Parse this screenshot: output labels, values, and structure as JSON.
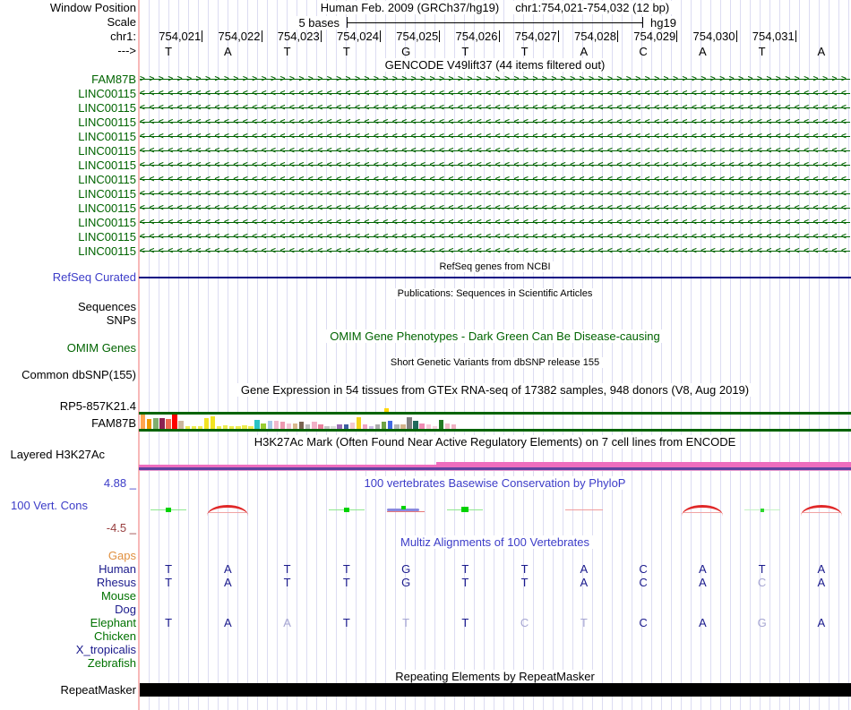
{
  "header": {
    "window_position_label": "Window Position",
    "assembly_title": "Human Feb. 2009 (GRCh37/hg19)",
    "position_title": "chr1:754,021-754,032 (12 bp)",
    "scale_label": "Scale",
    "scale_value": "5 bases",
    "assembly_tag": "hg19",
    "chrom_label": "chr1:",
    "strand_label": "--->"
  },
  "ruler": {
    "coordinates": [
      "754,021",
      "754,022",
      "754,023",
      "754,024",
      "754,025",
      "754,026",
      "754,027",
      "754,028",
      "754,029",
      "754,030",
      "754,031"
    ]
  },
  "sequence": {
    "bases": [
      "T",
      "A",
      "T",
      "T",
      "G",
      "T",
      "T",
      "A",
      "C",
      "A",
      "T",
      "A"
    ]
  },
  "gencode": {
    "title": "GENCODE V49lift37 (44 items filtered out)",
    "genes": [
      {
        "label": "FAM87B",
        "strand": ">"
      },
      {
        "label": "LINC00115",
        "strand": "<"
      },
      {
        "label": "LINC00115",
        "strand": "<"
      },
      {
        "label": "LINC00115",
        "strand": "<"
      },
      {
        "label": "LINC00115",
        "strand": "<"
      },
      {
        "label": "LINC00115",
        "strand": "<"
      },
      {
        "label": "LINC00115",
        "strand": "<"
      },
      {
        "label": "LINC00115",
        "strand": "<"
      },
      {
        "label": "LINC00115",
        "strand": "<"
      },
      {
        "label": "LINC00115",
        "strand": "<"
      },
      {
        "label": "LINC00115",
        "strand": "<"
      },
      {
        "label": "LINC00115",
        "strand": "<"
      },
      {
        "label": "LINC00115",
        "strand": "<"
      }
    ]
  },
  "refseq": {
    "title": "RefSeq genes from NCBI",
    "label": "RefSeq Curated"
  },
  "publications": {
    "title": "Publications: Sequences in Scientific Articles",
    "label": "Sequences"
  },
  "snps": {
    "label": "SNPs"
  },
  "omim": {
    "title": "OMIM Gene Phenotypes - Dark Green Can Be Disease-causing",
    "label": "OMIM Genes"
  },
  "dbsnp": {
    "title": "Short Genetic Variants from dbSNP release 155",
    "label": "Common dbSNP(155)"
  },
  "gtex": {
    "title": "Gene Expression in 54 tissues from GTEx RNA-seq of 17382 samples, 948 donors (V8, Aug 2019)",
    "gene1_label": "RP5-857K21.4",
    "gene2_label": "FAM87B",
    "bars": [
      {
        "c": "#FFA54F",
        "h": 16
      },
      {
        "c": "#EE9A00",
        "h": 11
      },
      {
        "c": "#7FAE6E",
        "h": 12
      },
      {
        "c": "#8B2252",
        "h": 12
      },
      {
        "c": "#EE6A50",
        "h": 11
      },
      {
        "c": "#FF0000",
        "h": 16
      },
      {
        "c": "#CDB79E",
        "h": 9
      },
      {
        "c": "#EDED4E",
        "h": 3
      },
      {
        "c": "#EDED4E",
        "h": 3
      },
      {
        "c": "#EDED4E",
        "h": 3
      },
      {
        "c": "#F2E422",
        "h": 12
      },
      {
        "c": "#F2E422",
        "h": 14
      },
      {
        "c": "#EDED4E",
        "h": 3
      },
      {
        "c": "#EDED4E",
        "h": 4
      },
      {
        "c": "#EDED4E",
        "h": 3
      },
      {
        "c": "#EDED4E",
        "h": 3
      },
      {
        "c": "#EDED4E",
        "h": 4
      },
      {
        "c": "#EDED4E",
        "h": 3
      },
      {
        "c": "#28C4C4",
        "h": 10
      },
      {
        "c": "#9ACD32",
        "h": 6
      },
      {
        "c": "#A9C8E8",
        "h": 9
      },
      {
        "c": "#F2B8CC",
        "h": 9
      },
      {
        "c": "#EE9AB0",
        "h": 8
      },
      {
        "c": "#F4C4D4",
        "h": 6
      },
      {
        "c": "#D9B98C",
        "h": 6
      },
      {
        "c": "#7A6652",
        "h": 8
      },
      {
        "c": "#BDBDBD",
        "h": 5
      },
      {
        "c": "#F2B0C6",
        "h": 8
      },
      {
        "c": "#E8829C",
        "h": 5
      },
      {
        "c": "#C4C4C4",
        "h": 3
      },
      {
        "c": "#DCDCDC",
        "h": 3
      },
      {
        "c": "#9B6FB4",
        "h": 5
      },
      {
        "c": "#3D5FA0",
        "h": 5
      },
      {
        "c": "#F4C8D2",
        "h": 7
      },
      {
        "c": "#F4D41E",
        "h": 13
      },
      {
        "c": "#F0A2C4",
        "h": 5
      },
      {
        "c": "#CCBCE4",
        "h": 3
      },
      {
        "c": "#ACACAC",
        "h": 5
      },
      {
        "c": "#6EA345",
        "h": 8
      },
      {
        "c": "#4169E1",
        "h": 9
      },
      {
        "c": "#B4B4B4",
        "h": 5
      },
      {
        "c": "#D2B48C",
        "h": 5
      },
      {
        "c": "#808080",
        "h": 13
      },
      {
        "c": "#20695B",
        "h": 9
      },
      {
        "c": "#F08CB4",
        "h": 6
      },
      {
        "c": "#F8C8D8",
        "h": 5
      },
      {
        "c": "#F6D2DE",
        "h": 3
      },
      {
        "c": "#237A23",
        "h": 10
      },
      {
        "c": "#F2BCC8",
        "h": 6
      },
      {
        "c": "#F0B2C2",
        "h": 5
      }
    ]
  },
  "h3k27ac": {
    "title": "H3K27Ac Mark (Often Found Near Active Regulatory Elements) on 7 cell lines from ENCODE",
    "label": "Layered H3K27Ac",
    "pink": "#EE6DBE",
    "purple": "#5F43A0",
    "light_pink": "#E89CD0"
  },
  "phylop": {
    "title": "100 vertebrates Basewise Conservation by PhyloP",
    "label": "100 Vert. Cons",
    "max_label": "4.88 _",
    "min_label": "-4.5 _",
    "marks": [
      "green",
      "red-arc",
      "none",
      "green",
      "mixed",
      "green-big",
      "none",
      "red-faint",
      "none",
      "red-arc",
      "green-faint",
      "red-arc"
    ]
  },
  "multiz": {
    "title": "Multiz Alignments of 100 Vertebrates",
    "species": [
      {
        "name": "Gaps",
        "color_class": "orange",
        "bases": null,
        "dim": []
      },
      {
        "name": "Human",
        "color_class": "blue",
        "bases": [
          "T",
          "A",
          "T",
          "T",
          "G",
          "T",
          "T",
          "A",
          "C",
          "A",
          "T",
          "A"
        ],
        "dim": []
      },
      {
        "name": "Rhesus",
        "color_class": "blue",
        "bases": [
          "T",
          "A",
          "T",
          "T",
          "G",
          "T",
          "T",
          "A",
          "C",
          "A",
          "C",
          "A"
        ],
        "dim": [
          10
        ]
      },
      {
        "name": "Mouse",
        "color_class": "green",
        "bases": null,
        "dim": []
      },
      {
        "name": "Dog",
        "color_class": "blue",
        "bases": null,
        "dim": []
      },
      {
        "name": "Elephant",
        "color_class": "green",
        "bases": [
          "T",
          "A",
          "A",
          "T",
          "T",
          "T",
          "C",
          "T",
          "C",
          "A",
          "G",
          "A"
        ],
        "dim": [
          2,
          4,
          6,
          7,
          10
        ]
      },
      {
        "name": "Chicken",
        "color_class": "green",
        "bases": null,
        "dim": []
      },
      {
        "name": "X_tropicalis",
        "color_class": "blue",
        "bases": null,
        "dim": []
      },
      {
        "name": "Zebrafish",
        "color_class": "green",
        "bases": null,
        "dim": []
      }
    ]
  },
  "repeatmasker": {
    "title": "Repeating Elements by RepeatMasker",
    "label": "RepeatMasker"
  },
  "colors": {
    "accent_blue": "#3C3CC8",
    "track_green": "#006400",
    "navy_line": "#050583",
    "grid": "#DCDCF2",
    "left_border_pink": "#F7B8B8"
  }
}
